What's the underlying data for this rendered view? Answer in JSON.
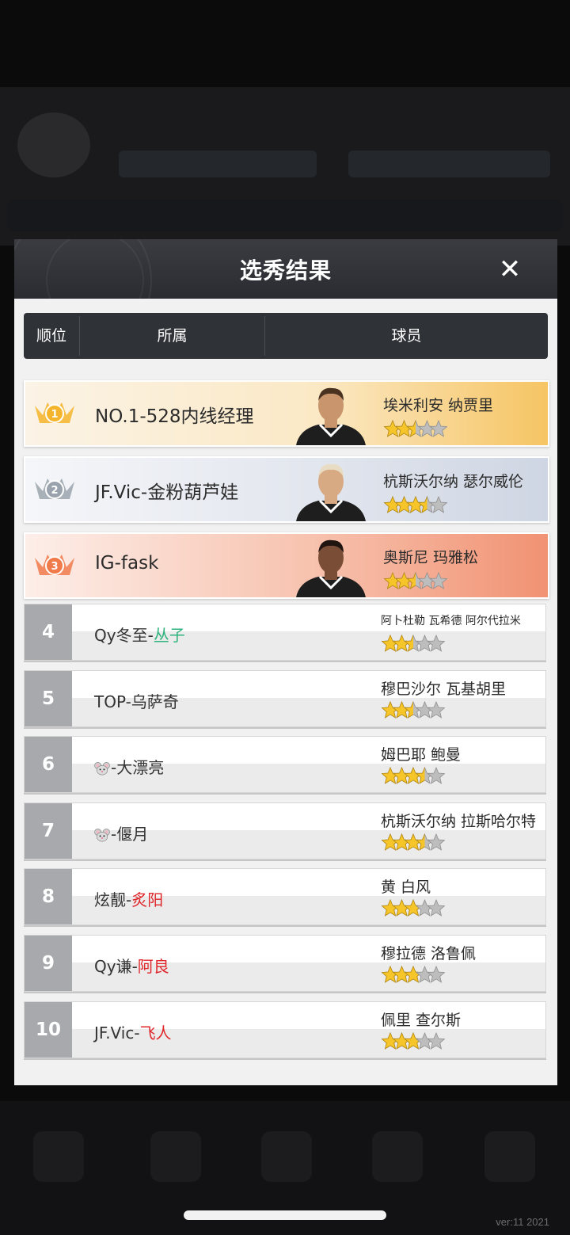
{
  "modal": {
    "title": "选秀结果",
    "close_label": "✕"
  },
  "columns": {
    "rank": "顺位",
    "team": "所属",
    "player": "球员"
  },
  "top_picks": [
    {
      "rank": "1",
      "team": "NO.1-528内线经理",
      "player": "埃米利安 纳贾里",
      "stars": 2.5,
      "skin": "#c8956d",
      "hair": "#4a3220"
    },
    {
      "rank": "2",
      "team": "JF.Vic-金粉葫芦娃",
      "player": "杭斯沃尔纳 瑟尔威伦",
      "stars": 3.5,
      "skin": "#d8aa84",
      "hair": "#e8ddc4"
    },
    {
      "rank": "3",
      "team": "IG-fask",
      "player": "奥斯尼 玛雅松",
      "stars": 2.5,
      "skin": "#7a4e36",
      "hair": "#1f1410"
    }
  ],
  "picks": [
    {
      "rank": "4",
      "team_prefix": "Qy冬至-",
      "team_highlight": "丛子",
      "highlight_color": "green",
      "player": "阿卜杜勒 瓦希德 阿尔代拉米",
      "player_size": "small",
      "stars": 2.5
    },
    {
      "rank": "5",
      "team_prefix": "TOP-乌萨奇",
      "team_highlight": "",
      "highlight_color": "",
      "player": "穆巴沙尔 瓦基胡里",
      "player_size": "normal",
      "stars": 2.5
    },
    {
      "rank": "6",
      "team_icon": "mouse-icon",
      "team_prefix": "-大漂亮",
      "team_highlight": "",
      "highlight_color": "",
      "player": "姆巴耶 鲍曼",
      "player_size": "normal",
      "stars": 3.5
    },
    {
      "rank": "7",
      "team_icon": "mouse-icon",
      "team_prefix": "-偃月",
      "team_highlight": "",
      "highlight_color": "",
      "player": "杭斯沃尔纳 拉斯哈尔特",
      "player_size": "normal",
      "stars": 3.5
    },
    {
      "rank": "8",
      "team_prefix": "炫靓-",
      "team_highlight": "炙阳",
      "highlight_color": "red",
      "player": "黄 白风",
      "player_size": "normal",
      "stars": 3
    },
    {
      "rank": "9",
      "team_prefix": "Qy谦-",
      "team_highlight": "阿良",
      "highlight_color": "red",
      "player": "穆拉德 洛鲁佩",
      "player_size": "normal",
      "stars": 3
    },
    {
      "rank": "10",
      "team_prefix": "JF.Vic-",
      "team_highlight": "飞人",
      "highlight_color": "red",
      "player": "佩里 查尔斯",
      "player_size": "normal",
      "stars": 3
    }
  ],
  "footer": {
    "version": "ver:11  2021"
  },
  "colors": {
    "gold": "#f4b52c",
    "silver": "#9aa3ad",
    "bronze": "#f07a4a",
    "star_gold": "#f5c52a",
    "star_grey": "#bdbdbd"
  }
}
